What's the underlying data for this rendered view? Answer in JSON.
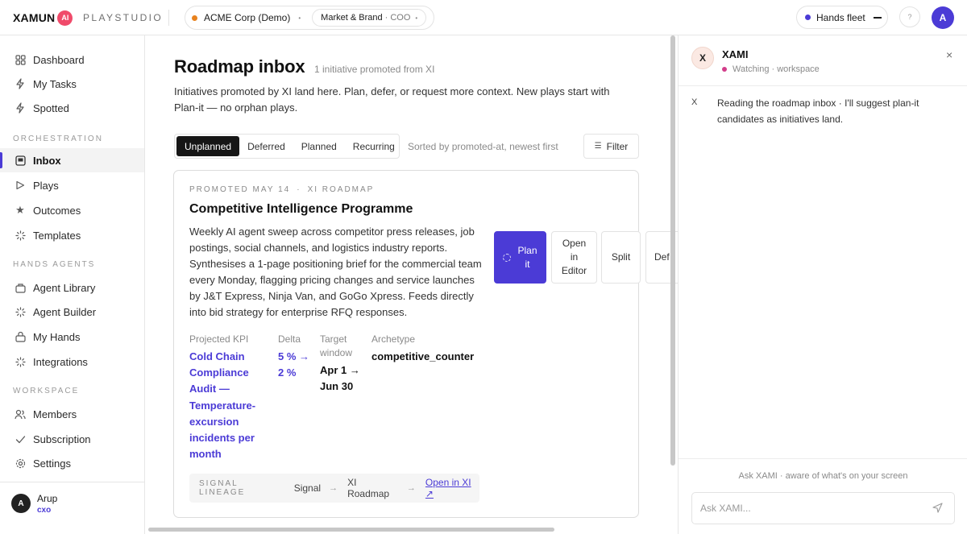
{
  "topbar": {
    "logo_text": "XAMUN",
    "logo_badge": "AI",
    "product": "PLAYSTUDIO",
    "org_name": "ACME Corp (Demo)",
    "role_name": "Market & Brand",
    "role_suffix": "· COO",
    "fleet_label": "Hands fleet",
    "help_icon": "?",
    "avatar_initial": "A"
  },
  "sidebar": {
    "items_top": [
      {
        "label": "Dashboard",
        "icon": "dashboard-icon"
      },
      {
        "label": "My Tasks",
        "icon": "bolt-icon"
      },
      {
        "label": "Spotted",
        "icon": "bolt-icon"
      }
    ],
    "section_orchestration": "ORCHESTRATION",
    "items_orchestration": [
      {
        "label": "Inbox",
        "icon": "inbox-icon",
        "active": true
      },
      {
        "label": "Plays",
        "icon": "play-icon"
      },
      {
        "label": "Outcomes",
        "icon": "star-icon"
      },
      {
        "label": "Templates",
        "icon": "spinner-icon"
      }
    ],
    "section_hands": "HANDS AGENTS",
    "items_hands": [
      {
        "label": "Agent Library",
        "icon": "library-icon"
      },
      {
        "label": "Agent Builder",
        "icon": "spinner-icon"
      },
      {
        "label": "My Hands",
        "icon": "hand-icon"
      },
      {
        "label": "Integrations",
        "icon": "spinner-icon"
      }
    ],
    "section_workspace": "WORKSPACE",
    "items_workspace": [
      {
        "label": "Members",
        "icon": "members-icon"
      },
      {
        "label": "Subscription",
        "icon": "check-icon"
      },
      {
        "label": "Settings",
        "icon": "gear-icon"
      }
    ],
    "user": {
      "initial": "A",
      "name": "Arup",
      "role": "cxo"
    }
  },
  "main": {
    "title": "Roadmap inbox",
    "subtitle": "1 initiative promoted from XI",
    "description": "Initiatives promoted by XI land here. Plan, defer, or request more context. New plays start with Plan-it — no orphan plays.",
    "tabs": [
      "Unplanned",
      "Deferred",
      "Planned",
      "Recurring"
    ],
    "active_tab": "Unplanned",
    "sort_note": "Sorted by promoted-at, newest first",
    "filter_label": "Filter",
    "card": {
      "eyebrow_date": "PROMOTED MAY 14",
      "eyebrow_sep": "·",
      "eyebrow_source": "XI ROADMAP",
      "title": "Competitive Intelligence Programme",
      "description": "Weekly AI agent sweep across competitor press releases, job postings, social channels, and logistics industry reports. Synthesises a 1-page positioning brief for the commercial team every Monday, flagging pricing changes and service launches by J&T Express, Ninja Van, and GoGo Xpress. Feeds directly into bid strategy for enterprise RFQ responses.",
      "kpi": {
        "projected_label": "Projected KPI",
        "projected_value": "Cold Chain Compliance Audit — Temperature-excursion incidents per month",
        "delta_label": "Delta",
        "delta_value": "5 % → 2 %",
        "window_label": "Target window",
        "window_value": "Apr 1 → Jun 30",
        "archetype_label": "Archetype",
        "archetype_value": "competitive_counter"
      },
      "actions": {
        "plan": "Plan it",
        "open_editor": "Open in Editor",
        "split": "Split",
        "defer": "Def"
      },
      "lineage": {
        "label": "SIGNAL LINEAGE",
        "step1": "Signal",
        "step2": "XI Roadmap",
        "link": "Open in XI ↗",
        "arrow": "→"
      }
    }
  },
  "panel": {
    "avatar": "X",
    "name": "XAMI",
    "status": "Watching · workspace",
    "close": "×",
    "message_marker": "X",
    "message": "Reading the roadmap inbox · I'll suggest plan-it candidates as initiatives land.",
    "ask_hint": "Ask XAMI · aware of what's on your screen",
    "input_placeholder": "Ask XAMI..."
  },
  "colors": {
    "accent": "#4b3bd6",
    "org_dot": "#e8821e",
    "status_dot": "#d23d8a",
    "logo_badge": "#f04a6a"
  }
}
